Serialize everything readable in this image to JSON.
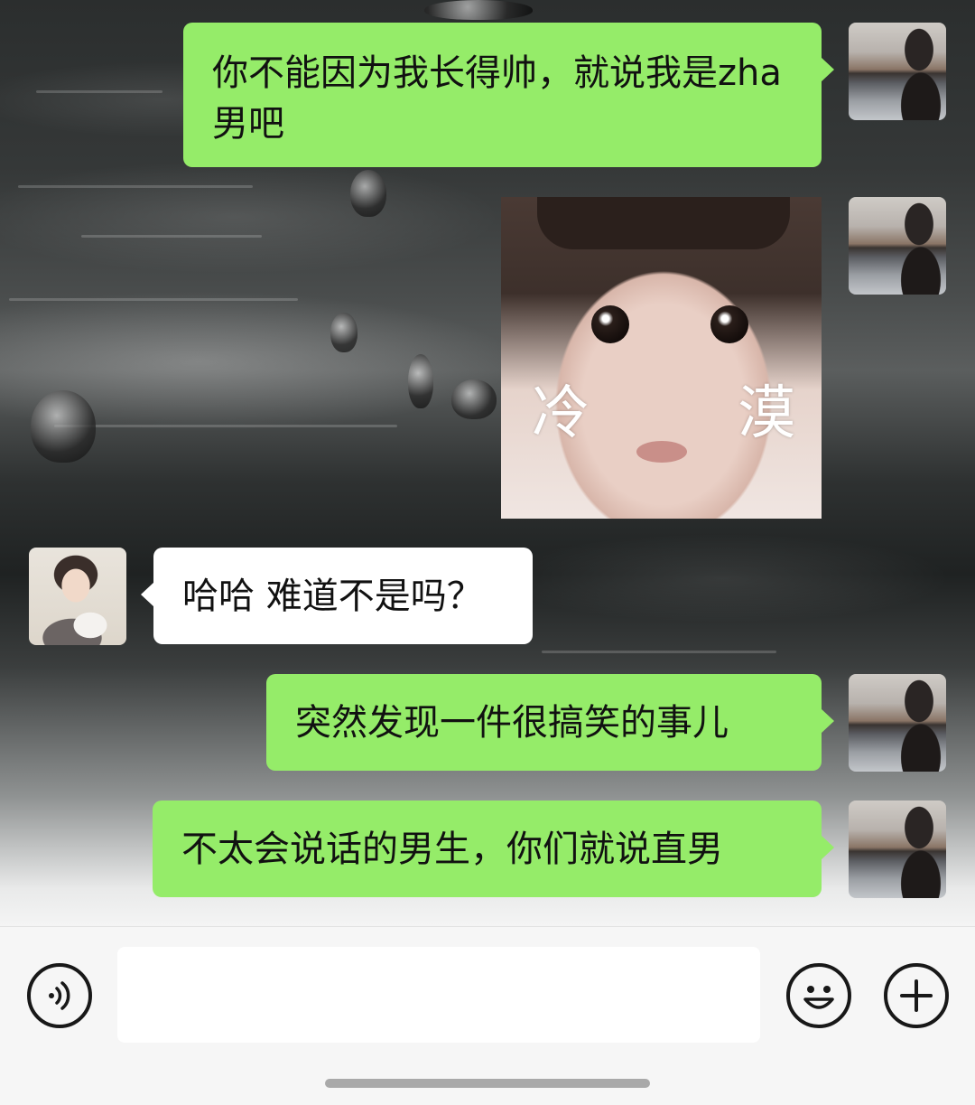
{
  "messages": [
    {
      "sender": "me",
      "type": "text",
      "text": "你不能因为我长得帅，就说我是zha 男吧"
    },
    {
      "sender": "me",
      "type": "sticker",
      "caption_left": "冷",
      "caption_right": "漠"
    },
    {
      "sender": "other",
      "type": "text",
      "text": "哈哈 难道不是吗？"
    },
    {
      "sender": "me",
      "type": "text",
      "text": "突然发现一件很搞笑的事儿"
    },
    {
      "sender": "me",
      "type": "text",
      "text": "不太会说话的男生，你们就说直男"
    }
  ],
  "input": {
    "value": "",
    "placeholder": ""
  },
  "icons": {
    "voice": "voice-icon",
    "emoji": "emoji-icon",
    "plus": "plus-icon"
  },
  "colors": {
    "my_bubble": "#95ec69",
    "their_bubble": "#ffffff",
    "input_bar": "#f6f6f6"
  }
}
